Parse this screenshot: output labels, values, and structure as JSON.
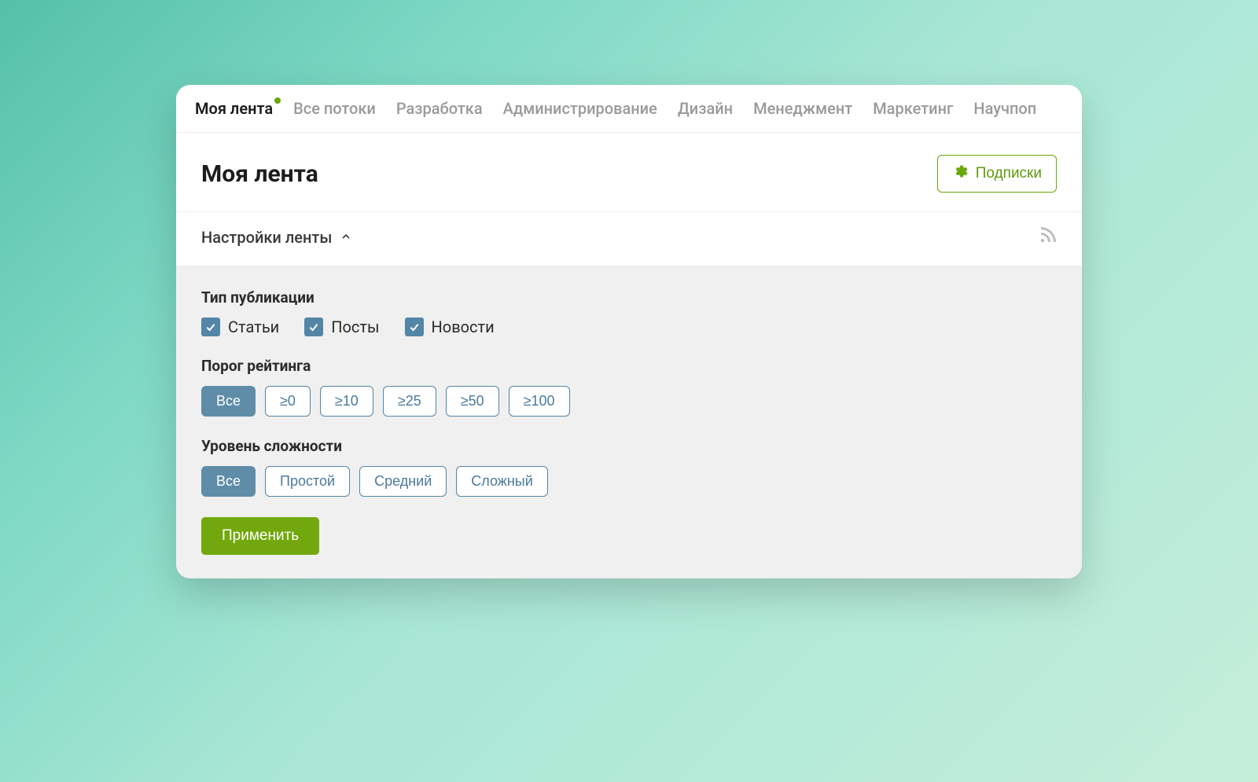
{
  "tabs": {
    "items": [
      {
        "label": "Моя лента",
        "active": true,
        "dot": true
      },
      {
        "label": "Все потоки"
      },
      {
        "label": "Разработка"
      },
      {
        "label": "Администрирование"
      },
      {
        "label": "Дизайн"
      },
      {
        "label": "Менеджмент"
      },
      {
        "label": "Маркетинг"
      },
      {
        "label": "Научпоп"
      }
    ]
  },
  "header": {
    "title": "Моя лента",
    "subscriptions_label": "Подписки"
  },
  "settings": {
    "toggle_label": "Настройки ленты"
  },
  "filters": {
    "type_label": "Тип публикации",
    "type_options": [
      {
        "label": "Статьи",
        "checked": true
      },
      {
        "label": "Посты",
        "checked": true
      },
      {
        "label": "Новости",
        "checked": true
      }
    ],
    "rating_label": "Порог рейтинга",
    "rating_options": [
      {
        "label": "Все",
        "active": true
      },
      {
        "label": "≥0"
      },
      {
        "label": "≥10"
      },
      {
        "label": "≥25"
      },
      {
        "label": "≥50"
      },
      {
        "label": "≥100"
      }
    ],
    "difficulty_label": "Уровень сложности",
    "difficulty_options": [
      {
        "label": "Все",
        "active": true
      },
      {
        "label": "Простой"
      },
      {
        "label": "Средний"
      },
      {
        "label": "Сложный"
      }
    ],
    "apply_label": "Применить"
  }
}
